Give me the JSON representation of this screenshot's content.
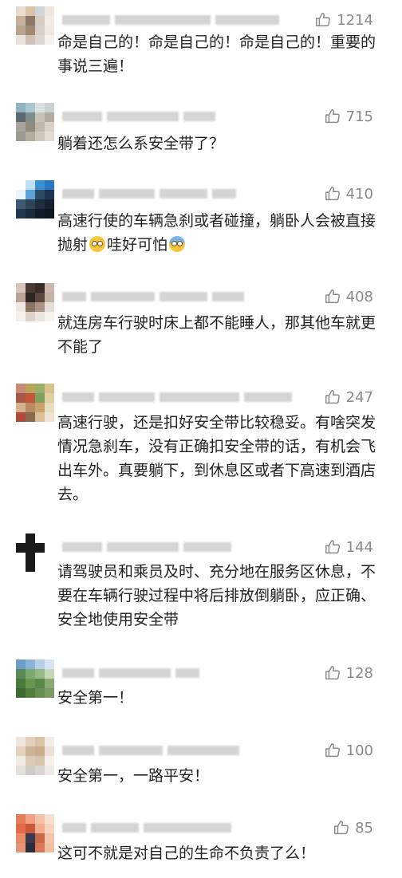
{
  "comments": [
    {
      "likes": "1214",
      "text": "命是自己的！命是自己的！命是自己的！重要的事说三遍！",
      "avatar_colors": [
        "#e8dcd0",
        "#d9c2a8",
        "#cfd6d9",
        "#efe7de",
        "#c6b09a",
        "#8c7a66",
        "#d5ccc2",
        "#f1ece6",
        "#b7a48e",
        "#a08a74",
        "#d8d0c6",
        "#eee8e1",
        "#e9e2da",
        "#cfc2b5",
        "#ddd6ce",
        "#f5f1ec"
      ]
    },
    {
      "likes": "715",
      "text": "躺着还怎么系安全带了？",
      "avatar_colors": [
        "#8db4bf",
        "#a9c7cf",
        "#d8e0e0",
        "#c9d3d0",
        "#5a6a70",
        "#7f8d8a",
        "#c7c2b5",
        "#b3ab9c",
        "#a6a49a",
        "#8e8a7e",
        "#c0b8aa",
        "#d9d2c6",
        "#9c9a8f",
        "#b4ad9e",
        "#cfc7b9",
        "#e2dcd1"
      ]
    },
    {
      "likes": "410",
      "text_before_emoji1": "高速行使的车辆急刹或者碰撞，躺卧人会被直接抛射",
      "text_mid": "哇好可怕",
      "emoji1": "flushed-face",
      "emoji2": "screaming-face",
      "avatar_colors": [
        "#ffffff",
        "#bfe0f2",
        "#3a8fd0",
        "#2a78c4",
        "#eaf4fb",
        "#5aa4dc",
        "#2c4a66",
        "#1d3450",
        "#3e5a72",
        "#2d4358",
        "#1e2e3e",
        "#152230",
        "#24364a",
        "#1b2a3a",
        "#121c28",
        "#0e1620"
      ]
    },
    {
      "likes": "408",
      "text": "就连房车行驶时床上都不能睡人，那其他车就更不能了",
      "avatar_colors": [
        "#d8c8bc",
        "#4a3a34",
        "#3a2c28",
        "#c9b8ab",
        "#b8a395",
        "#2e2420",
        "#5a463e",
        "#c4b2a4",
        "#efe8e2",
        "#8a7464",
        "#a89486",
        "#e6ddd6",
        "#f4efea",
        "#dcd2ca",
        "#ece5df",
        "#f7f3ef"
      ]
    },
    {
      "likes": "247",
      "text": "高速行驶，还是扣好安全带比较稳妥。有啥突发情况急刹车，没有正确扣安全带的话，有机会飞出车外。真要躺下，到休息区或者下高速到酒店去。",
      "avatar_colors": [
        "#c98a7a",
        "#b9a45a",
        "#9ab06a",
        "#d6c48a",
        "#a85848",
        "#c4563e",
        "#7fa05a",
        "#e0cfa0",
        "#d4b28a",
        "#b88a64",
        "#c9a070",
        "#e8dcc0",
        "#b04a3a",
        "#8a6a4a",
        "#d8c098",
        "#efe4cf"
      ]
    },
    {
      "likes": "144",
      "text": "请驾驶员和乘员及时、充分地在服务区休息，不要在车辆行驶过程中将后排放倒躺卧，应正确、安全地使用安全带",
      "avatar_colors": [
        "#ffffff",
        "#1a1a1a",
        "#ffffff",
        "#ffffff",
        "#1a1a1a",
        "#1a1a1a",
        "#1a1a1a",
        "#ffffff",
        "#ffffff",
        "#1a1a1a",
        "#ffffff",
        "#ffffff",
        "#ffffff",
        "#1a1a1a",
        "#ffffff",
        "#ffffff"
      ]
    },
    {
      "likes": "128",
      "text": "安全第一！",
      "avatar_colors": [
        "#6c9cc8",
        "#8ab3da",
        "#b7d0e6",
        "#d7e5f2",
        "#5a8a5a",
        "#7aa870",
        "#94b886",
        "#c3d6b6",
        "#4a7a3a",
        "#6a9450",
        "#5a8648",
        "#8aa874",
        "#3d6a30",
        "#527e3e",
        "#6a8e50",
        "#7a9a60"
      ]
    },
    {
      "likes": "100",
      "text": "安全第一，一路平安！",
      "avatar_colors": [
        "#efe6dc",
        "#e2cfbb",
        "#d9c2a7",
        "#f4ede5",
        "#e6d3bd",
        "#cdb496",
        "#c9ad8c",
        "#ebe0d3",
        "#f2ebe3",
        "#ddcab4",
        "#d6c3ad",
        "#f5f0ea",
        "#e4e0dc",
        "#cfcac5",
        "#dad5d0",
        "#eeeae6"
      ]
    },
    {
      "likes": "85",
      "text": "这可不就是对自己的生命不负责了么！",
      "avatar_colors": [
        "#e47a5a",
        "#f0a080",
        "#f3c0a8",
        "#f8e0d0",
        "#e06a4a",
        "#c85a3a",
        "#f2b090",
        "#f6d4c0",
        "#e88a6a",
        "#3a3a4a",
        "#c86a4a",
        "#f4c4a8",
        "#e69478",
        "#2c2c3a",
        "#d87a5a",
        "#f0c0a4"
      ]
    }
  ]
}
